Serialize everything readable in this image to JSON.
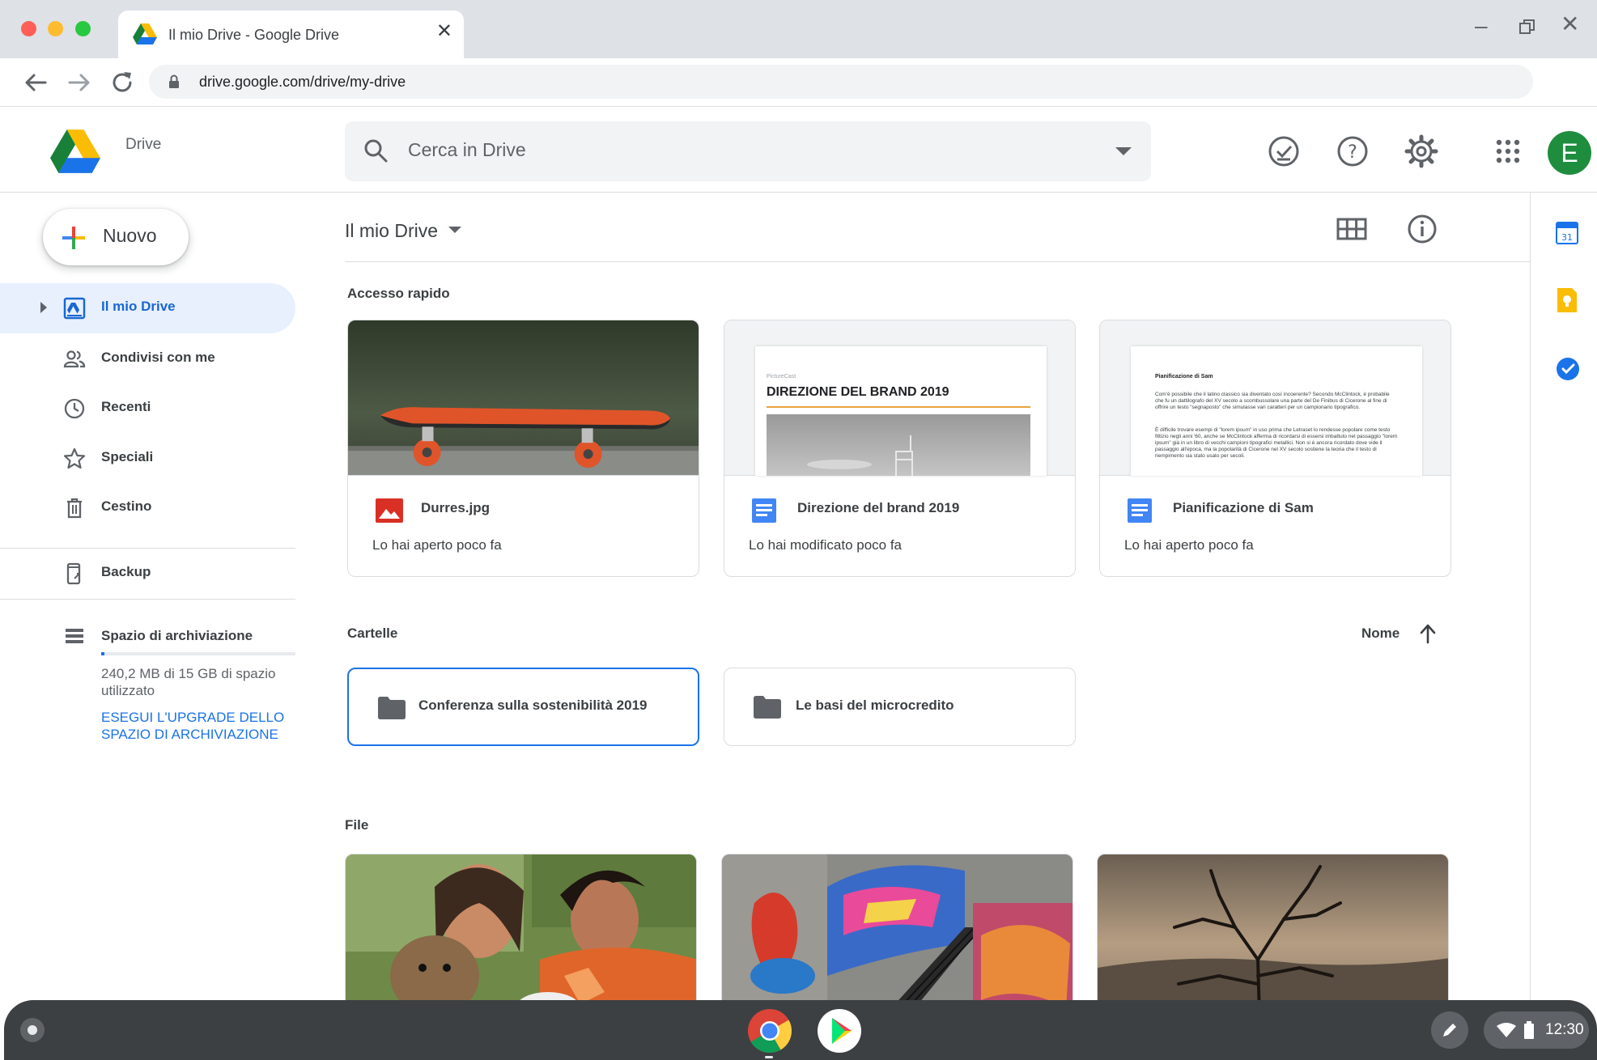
{
  "browser": {
    "tab_title": "Il mio Drive - Google Drive",
    "url": "drive.google.com/drive/my-drive"
  },
  "header": {
    "brand": "Drive",
    "search_placeholder": "Cerca in Drive",
    "avatar_initial": "E"
  },
  "sidebar": {
    "new_label": "Nuovo",
    "items": [
      {
        "label": "Il mio Drive",
        "icon": "my-drive-icon",
        "active": true
      },
      {
        "label": "Condivisi con me",
        "icon": "shared-icon"
      },
      {
        "label": "Recenti",
        "icon": "clock-icon"
      },
      {
        "label": "Speciali",
        "icon": "star-icon"
      },
      {
        "label": "Cestino",
        "icon": "trash-icon"
      }
    ],
    "backup": {
      "label": "Backup",
      "icon": "backup-icon"
    },
    "storage": {
      "label": "Spazio di archiviazione",
      "usage": "240,2 MB di 15 GB di spazio utilizzato",
      "upgrade": "ESEGUI L'UPGRADE DELLO SPAZIO DI ARCHIVIAZIONE",
      "used_fraction": 0.016
    }
  },
  "main": {
    "title": "Il mio Drive",
    "quick_access_label": "Accesso rapido",
    "quick_access": [
      {
        "name": "Durres.jpg",
        "sub": "Lo hai aperto poco fa",
        "type": "image"
      },
      {
        "name": "Direzione del brand 2019",
        "sub": "Lo hai modificato poco fa",
        "type": "doc",
        "doc_brand": "PictureCast",
        "doc_heading": "DIREZIONE DEL BRAND 2019"
      },
      {
        "name": "Pianificazione di Sam",
        "sub": "Lo hai aperto poco fa",
        "type": "doc",
        "doc_heading": "Pianificazione di Sam",
        "doc_p1": "Com'è possibile che il latino classico sia diventato così incoerente? Secondo McClintock, è probabile che fu un dattilografo del XV secolo a scombussolare una parte del De Finibus di Cicerone al fine di offrire un testo \"segnaposto\" che simulasse vari caratteri per un campionario tipografico.",
        "doc_p2": "È difficile trovare esempi di \"lorem ipsum\" in uso prima che Letraset lo rendesse popolare come testo fittizio negli anni '60, anche se McClintock afferma di ricordarsi di essersi imbattuto nel passaggio \"lorem ipsum\" già in un libro di vecchi campioni tipografici metallici. Non si è ancora ricordato dove vide il passaggio all'epoca, ma la popolarità di Cicerone nel XV secolo sostiene la teoria che il testo di riempimento sia stato usato per secoli."
      }
    ],
    "folders_label": "Cartelle",
    "sort_label": "Nome",
    "folders": [
      {
        "name": "Conferenza sulla sostenibilità 2019",
        "selected": true
      },
      {
        "name": "Le basi del microcredito",
        "selected": false
      }
    ],
    "files_label": "File"
  },
  "shelf": {
    "time": "12:30"
  },
  "colors": {
    "accent": "#1a73e8",
    "active_bg": "#e8f0fe",
    "avatar": "#1e8e3e"
  }
}
